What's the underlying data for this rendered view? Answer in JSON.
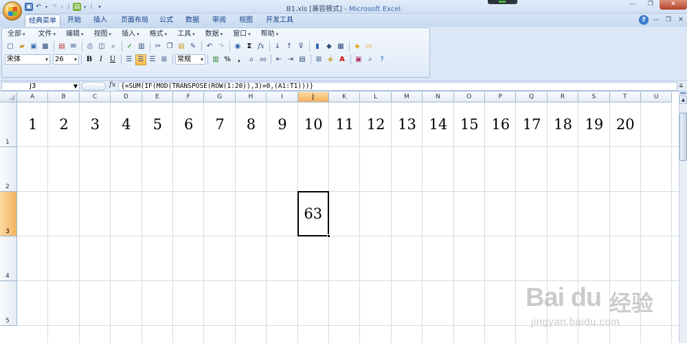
{
  "window": {
    "title": "B1.xls  [兼容模式] - ",
    "app_name": "Microsoft Excel"
  },
  "qat_icons": [
    "save-icon",
    "undo-icon",
    "redo-icon",
    "template-icon",
    "customize-icon"
  ],
  "ribbon_tabs": [
    {
      "label": "经典菜单",
      "active": true
    },
    {
      "label": "开始",
      "active": false
    },
    {
      "label": "插入",
      "active": false
    },
    {
      "label": "页面布局",
      "active": false
    },
    {
      "label": "公式",
      "active": false
    },
    {
      "label": "数据",
      "active": false
    },
    {
      "label": "审阅",
      "active": false
    },
    {
      "label": "视图",
      "active": false
    },
    {
      "label": "开发工具",
      "active": false
    }
  ],
  "menus": [
    "全部",
    "文件",
    "编辑",
    "视图",
    "插入",
    "格式",
    "工具",
    "数据",
    "窗口",
    "帮助"
  ],
  "format_toolbar": {
    "font_name": "宋体",
    "font_size": "26",
    "bold": "B",
    "italic": "I",
    "underline": "U",
    "number_format": "常规",
    "percent": "%",
    "comma": ","
  },
  "formula_bar": {
    "name_box": "J3",
    "fx": "fx",
    "formula": "{=SUM(IF(MOD(TRANSPOSE(ROW(1:20)),3)=0,(A1:T1)))}"
  },
  "sheet": {
    "columns": [
      "A",
      "B",
      "C",
      "D",
      "E",
      "F",
      "G",
      "H",
      "I",
      "J",
      "K",
      "L",
      "M",
      "N",
      "O",
      "P",
      "Q",
      "R",
      "S",
      "T",
      "U"
    ],
    "active_column": "J",
    "rows": [
      "1",
      "2",
      "3",
      "4",
      "5"
    ],
    "active_row": "3",
    "row1_values": [
      "1",
      "2",
      "3",
      "4",
      "5",
      "6",
      "7",
      "8",
      "9",
      "10",
      "11",
      "12",
      "13",
      "14",
      "15",
      "16",
      "17",
      "18",
      "19",
      "20"
    ],
    "active_cell_value": "63"
  },
  "watermark": {
    "brand": "Bai du",
    "cn": "经验",
    "url": "jingyan.baidu.com"
  },
  "colors": {
    "active_header": "#f3b35f",
    "ribbon_bg": "#dbe7f6",
    "gridline": "#d4dbe5"
  }
}
